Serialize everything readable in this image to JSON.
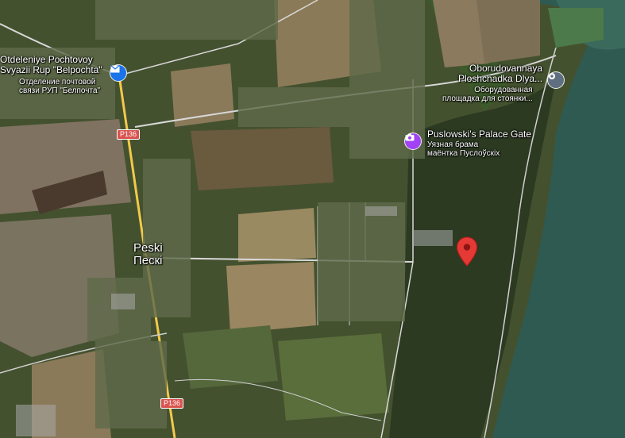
{
  "map": {
    "places": [
      {
        "name_line1": "Otdeleniye Pochtovoy",
        "name_line2": "Svyazii Rup \"Belpochta\"",
        "local_line1": "Отделение почтовой",
        "local_line2": "связи РУП \"Белпочта\"",
        "icon": "mail-icon"
      },
      {
        "name_line1": "Oborudovannaya",
        "name_line2": "Ploshchadka Dlya...",
        "local_line1": "Оборудованная",
        "local_line2": "площадка для стоянки...",
        "icon": "location-icon"
      },
      {
        "name_line1": "Puslowski's Palace Gate",
        "local_line1": "Уязная брама",
        "local_line2": "маёнтка Пуслоўскіх",
        "icon": "camera-icon"
      }
    ],
    "town": {
      "name": "Peski",
      "local": "Пескі"
    },
    "roads": [
      {
        "label": "P136"
      },
      {
        "label": "P136"
      }
    ],
    "colors": {
      "field_light": "#8a7a5a",
      "field_green": "#4d5a33",
      "forest": "#2c3a22",
      "water": "#2f5a52",
      "road_main": "#f2c94c",
      "road_minor": "#c9c9c9",
      "marker_red": "#e53935",
      "poi_mail": "#1a73e8",
      "poi_camera": "#a142f4",
      "poi_location": "#5f6f7f"
    }
  }
}
